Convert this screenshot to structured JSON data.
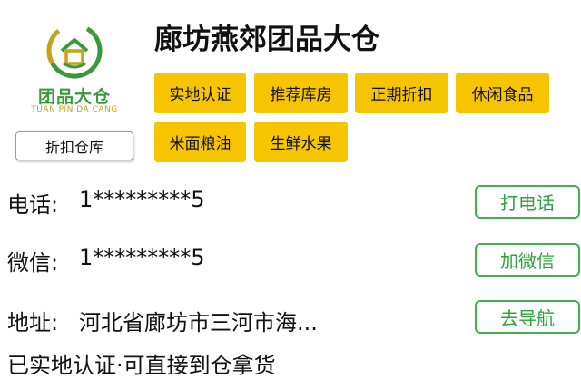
{
  "logo": {
    "cn": "团品大仓",
    "en": "TUAN PIN DA CANG"
  },
  "category_label": "折扣仓库",
  "store_title": "廊坊燕郊团品大仓",
  "tags": [
    "实地认证",
    "推荐库房",
    "正期折扣",
    "休闲食品",
    "米面粮油",
    "生鲜水果"
  ],
  "contact": {
    "phone": {
      "label": "电话:",
      "value": "1*********5",
      "action": "打电话"
    },
    "wechat": {
      "label": "微信:",
      "value": "1*********5",
      "action": "加微信"
    },
    "address": {
      "label": "地址:",
      "value": "河北省廊坊市三河市海...",
      "action": "去导航"
    }
  },
  "note": "已实地认证·可直接到仓拿货",
  "colors": {
    "tag_bg": "#f7c400",
    "action_green": "#3cb44b",
    "logo_green": "#3a9a3a",
    "logo_gold": "#c8a21a"
  }
}
